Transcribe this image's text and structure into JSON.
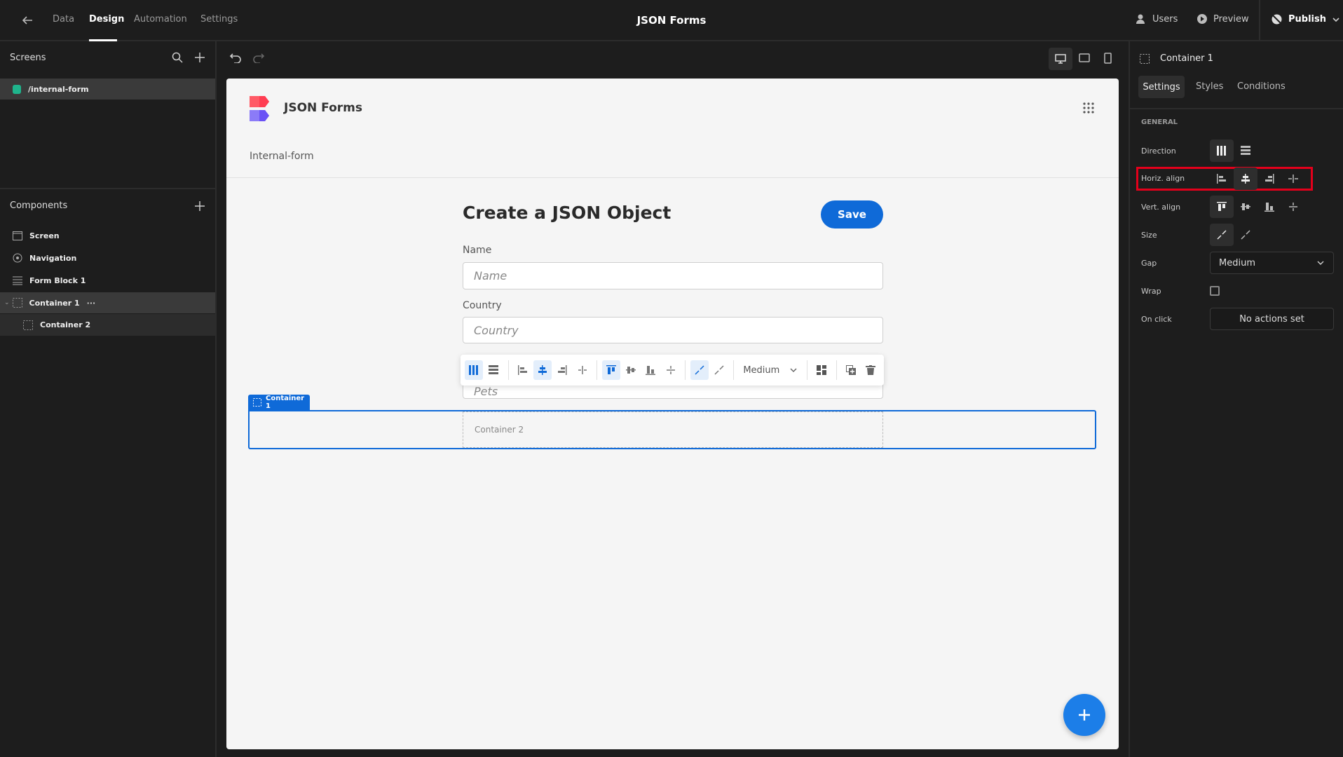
{
  "topbar": {
    "tabs": [
      "Data",
      "Design",
      "Automation",
      "Settings"
    ],
    "active_tab": "Design",
    "title": "JSON Forms",
    "users": "Users",
    "preview": "Preview",
    "publish": "Publish"
  },
  "screens": {
    "header": "Screens",
    "items": [
      {
        "label": "/internal-form",
        "color": "#1fb48c"
      }
    ]
  },
  "components": {
    "header": "Components",
    "items": [
      "Screen",
      "Navigation",
      "Form Block 1",
      "Container 1",
      "Container 2"
    ]
  },
  "app": {
    "name": "JSON Forms",
    "page": "Internal-form",
    "form_title": "Create a JSON Object",
    "save": "Save",
    "fields": [
      {
        "label": "Name",
        "placeholder": "Name"
      },
      {
        "label": "Country",
        "placeholder": "Country"
      },
      {
        "placeholder": "Pets"
      }
    ],
    "container1_tag": "Container 1",
    "container2": "Container 2"
  },
  "floating_toolbar": {
    "gap": "Medium"
  },
  "panel": {
    "title": "Container 1",
    "tabs": [
      "Settings",
      "Styles",
      "Conditions"
    ],
    "active_tab": "Settings",
    "section": "GENERAL",
    "labels": {
      "direction": "Direction",
      "horiz": "Horiz. align",
      "vert": "Vert. align",
      "size": "Size",
      "gap": "Gap",
      "wrap": "Wrap",
      "onclick": "On click"
    },
    "gap_value": "Medium",
    "wrap": false,
    "onclick_value": "No actions set",
    "selected": {
      "direction": "columns",
      "horiz_align": "center",
      "vert_align": "top",
      "size": "shrink"
    }
  },
  "colors": {
    "accent": "#0f6ad8",
    "highlight": "#e3001b"
  }
}
